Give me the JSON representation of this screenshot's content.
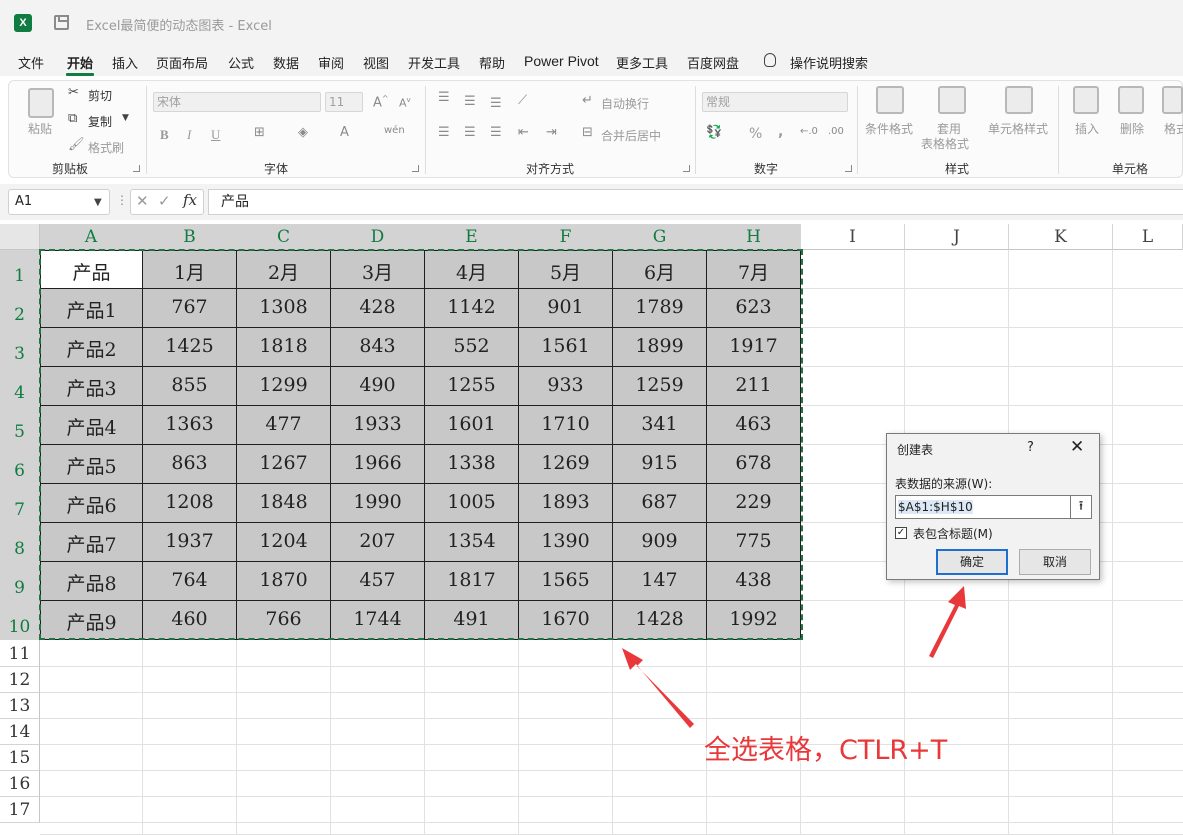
{
  "window": {
    "title": "Excel最简便的动态图表 - Excel",
    "logo_letter": "X"
  },
  "menu": {
    "tabs": [
      "文件",
      "开始",
      "插入",
      "页面布局",
      "公式",
      "数据",
      "审阅",
      "视图",
      "开发工具",
      "帮助",
      "Power Pivot",
      "更多工具",
      "百度网盘"
    ],
    "active_tab": "开始",
    "search": "操作说明搜索"
  },
  "ribbon": {
    "clipboard": {
      "paste": "粘贴",
      "cut": "剪切",
      "copy": "复制",
      "format_painter": "格式刷",
      "group": "剪贴板"
    },
    "font": {
      "font_name": "宋体",
      "font_size": "11",
      "bold": "B",
      "italic": "I",
      "underline": "U",
      "group": "字体"
    },
    "alignment": {
      "wrap": "自动换行",
      "merge": "合并后居中",
      "group": "对齐方式"
    },
    "number": {
      "format": "常规",
      "percent": "%",
      "comma": ",",
      "group": "数字"
    },
    "styles": {
      "conditional": "条件格式",
      "table_format_1": "套用",
      "table_format_2": "表格格式",
      "cell_styles": "单元格样式",
      "group": "样式"
    },
    "cells": {
      "insert": "插入",
      "delete": "删除",
      "format": "格式",
      "group": "单元格"
    }
  },
  "formula_bar": {
    "name_box": "A1",
    "fx": "fx",
    "value": "产品"
  },
  "columns": [
    "A",
    "B",
    "C",
    "D",
    "E",
    "F",
    "G",
    "H",
    "I",
    "J",
    "K",
    "L"
  ],
  "rows": [
    "1",
    "2",
    "3",
    "4",
    "5",
    "6",
    "7",
    "8",
    "9",
    "10",
    "11",
    "12",
    "13",
    "14",
    "15",
    "16",
    "17"
  ],
  "table": {
    "header": [
      "产品",
      "1月",
      "2月",
      "3月",
      "4月",
      "5月",
      "6月",
      "7月"
    ],
    "rows": [
      [
        "产品1",
        "767",
        "1308",
        "428",
        "1142",
        "901",
        "1789",
        "623"
      ],
      [
        "产品2",
        "1425",
        "1818",
        "843",
        "552",
        "1561",
        "1899",
        "1917"
      ],
      [
        "产品3",
        "855",
        "1299",
        "490",
        "1255",
        "933",
        "1259",
        "211"
      ],
      [
        "产品4",
        "1363",
        "477",
        "1933",
        "1601",
        "1710",
        "341",
        "463"
      ],
      [
        "产品5",
        "863",
        "1267",
        "1966",
        "1338",
        "1269",
        "915",
        "678"
      ],
      [
        "产品6",
        "1208",
        "1848",
        "1990",
        "1005",
        "1893",
        "687",
        "229"
      ],
      [
        "产品7",
        "1937",
        "1204",
        "207",
        "1354",
        "1390",
        "909",
        "775"
      ],
      [
        "产品8",
        "764",
        "1870",
        "457",
        "1817",
        "1565",
        "147",
        "438"
      ],
      [
        "产品9",
        "460",
        "766",
        "1744",
        "491",
        "1670",
        "1428",
        "1992"
      ]
    ]
  },
  "dialog": {
    "title": "创建表",
    "help": "?",
    "close": "✕",
    "source_label": "表数据的来源(W):",
    "source_value": "$A$1:$H$10",
    "has_headers": "表包含标题(M)",
    "has_headers_checked": true,
    "ok": "确定",
    "cancel": "取消"
  },
  "annotation": "全选表格，CTLR+T",
  "colors": {
    "excel_green": "#107c41",
    "selection_fill": "#c8c8c8",
    "annotation_red": "#e8383a"
  }
}
